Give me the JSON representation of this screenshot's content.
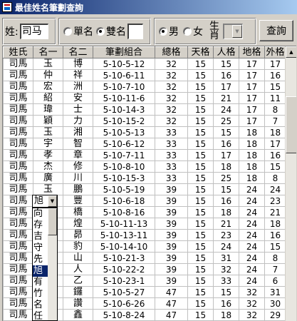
{
  "window": {
    "title": "最佳姓名筆劃查詢"
  },
  "toolbar": {
    "surname_label": "姓:",
    "surname_value": "司马",
    "single_name_label": "單名",
    "double_name_label": "雙名",
    "name_type_selected": "雙名",
    "male_label": "男",
    "female_label": "女",
    "gender_selected": "男",
    "zodiac_label": "生肖",
    "zodiac_value": "",
    "query_button": "查詢"
  },
  "grid": {
    "columns": [
      "姓氏",
      "名一",
      "名二",
      "筆劃組合",
      "總格",
      "天格",
      "人格",
      "地格",
      "外格"
    ],
    "rows": [
      [
        "司馬",
        "玉",
        "博",
        "5-10-5-12",
        "32",
        "15",
        "15",
        "17",
        "17"
      ],
      [
        "司馬",
        "仲",
        "祥",
        "5-10-6-11",
        "32",
        "15",
        "16",
        "17",
        "16"
      ],
      [
        "司馬",
        "宏",
        "洲",
        "5-10-7-10",
        "32",
        "15",
        "17",
        "17",
        "15"
      ],
      [
        "司馬",
        "紹",
        "安",
        "5-10-11-6",
        "32",
        "15",
        "21",
        "17",
        "11"
      ],
      [
        "司馬",
        "瑋",
        "士",
        "5-10-14-3",
        "32",
        "15",
        "24",
        "17",
        "8"
      ],
      [
        "司馬",
        "穎",
        "力",
        "5-10-15-2",
        "32",
        "15",
        "25",
        "17",
        "7"
      ],
      [
        "司馬",
        "玉",
        "湘",
        "5-10-5-13",
        "33",
        "15",
        "15",
        "18",
        "18"
      ],
      [
        "司馬",
        "宇",
        "智",
        "5-10-6-12",
        "33",
        "15",
        "16",
        "18",
        "17"
      ],
      [
        "司馬",
        "孝",
        "章",
        "5-10-7-11",
        "33",
        "15",
        "17",
        "18",
        "16"
      ],
      [
        "司馬",
        "杰",
        "修",
        "5-10-8-10",
        "33",
        "15",
        "18",
        "18",
        "15"
      ],
      [
        "司馬",
        "廣",
        "川",
        "5-10-15-3",
        "33",
        "15",
        "25",
        "18",
        "8"
      ],
      [
        "司馬",
        "玉",
        "鵬",
        "5-10-5-19",
        "39",
        "15",
        "15",
        "24",
        "24"
      ],
      [
        "司馬",
        "",
        "豐",
        "5-10-6-18",
        "39",
        "15",
        "16",
        "24",
        "23"
      ],
      [
        "司馬",
        "",
        "橋",
        "5-10-8-16",
        "39",
        "15",
        "18",
        "24",
        "21"
      ],
      [
        "司馬",
        "",
        "煌",
        "5-10-11-13",
        "39",
        "15",
        "21",
        "24",
        "18"
      ],
      [
        "司馬",
        "",
        "昴",
        "5-10-13-11",
        "39",
        "15",
        "23",
        "24",
        "16"
      ],
      [
        "司馬",
        "",
        "豹",
        "5-10-14-10",
        "39",
        "15",
        "24",
        "24",
        "15"
      ],
      [
        "司馬",
        "",
        "山",
        "5-10-21-3",
        "39",
        "15",
        "31",
        "24",
        "8"
      ],
      [
        "司馬",
        "",
        "人",
        "5-10-22-2",
        "39",
        "15",
        "32",
        "24",
        "7"
      ],
      [
        "司馬",
        "",
        "乙",
        "5-10-23-1",
        "39",
        "15",
        "33",
        "24",
        "6"
      ],
      [
        "司馬",
        "",
        "鑼",
        "5-10-5-27",
        "47",
        "15",
        "15",
        "32",
        "31"
      ],
      [
        "司馬",
        "",
        "讚",
        "5-10-6-26",
        "47",
        "15",
        "16",
        "32",
        "30"
      ],
      [
        "司馬",
        "",
        "鑫",
        "5-10-8-24",
        "47",
        "15",
        "18",
        "32",
        "29"
      ],
      [
        "司馬",
        "",
        "鬚",
        "5-10-13-19",
        "47",
        "15",
        "23",
        "32",
        "24"
      ]
    ]
  },
  "name_dropdown": {
    "value": "旭",
    "options": [
      "向",
      "存",
      "吉",
      "守",
      "先",
      "旭",
      "有",
      "竹",
      "名",
      "任",
      "西"
    ],
    "selected": "旭"
  }
}
